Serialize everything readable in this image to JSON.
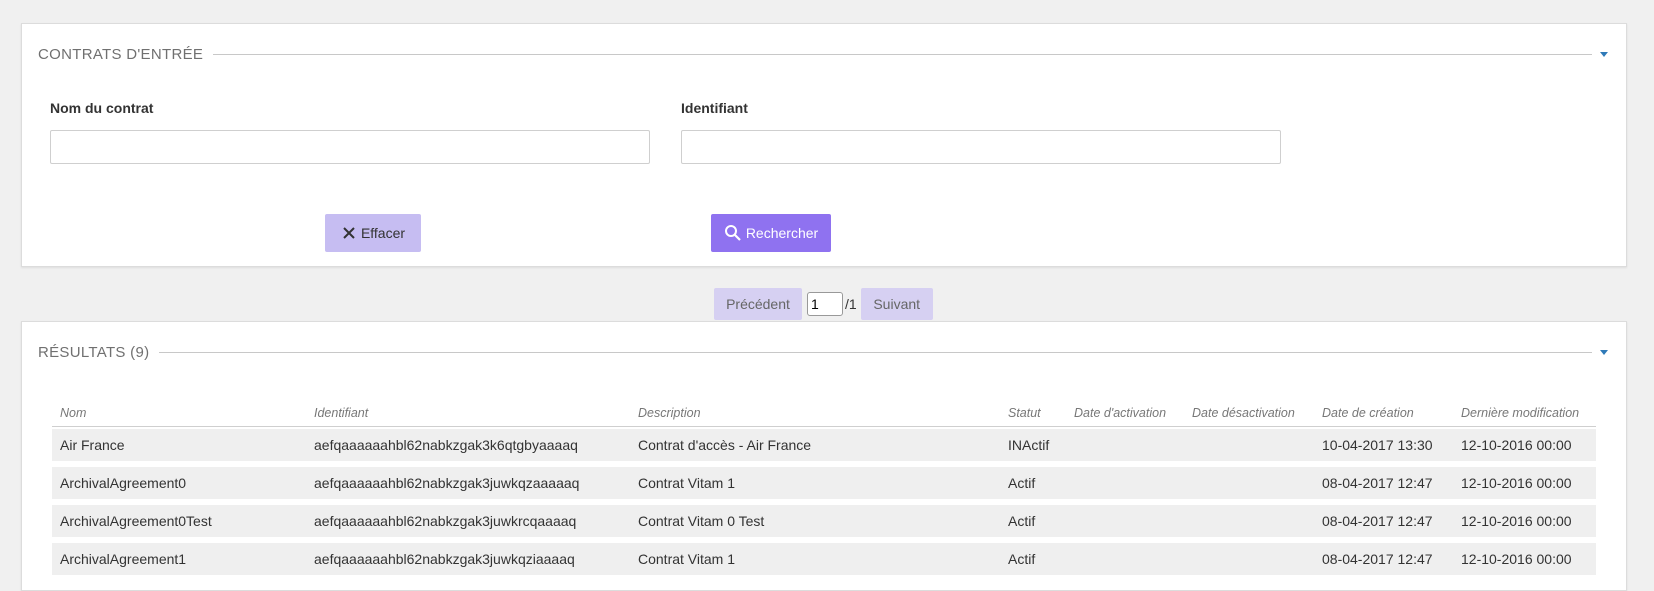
{
  "search_panel": {
    "title": "CONTRATS D'ENTRÉE",
    "fields": {
      "name_label": "Nom du contrat",
      "name_value": "",
      "id_label": "Identifiant",
      "id_value": ""
    },
    "clear_label": "Effacer",
    "search_label": "Rechercher"
  },
  "pager": {
    "prev_label": "Précédent",
    "page": "1",
    "total": "/1",
    "next_label": "Suivant"
  },
  "results_panel": {
    "title": "RÉSULTATS (9)",
    "columns": [
      "Nom",
      "Identifiant",
      "Description",
      "Statut",
      "Date d'activation",
      "Date désactivation",
      "Date de création",
      "Dernière modification"
    ],
    "rows": [
      {
        "nom": "Air France",
        "identifiant": "aefqaaaaaahbl62nabkzgak3k6qtgbyaaaaq",
        "description": "Contrat d'accès - Air France",
        "statut": "INActif",
        "activation": "",
        "desactivation": "",
        "creation": "10-04-2017 13:30",
        "modification": "12-10-2016 00:00"
      },
      {
        "nom": "ArchivalAgreement0",
        "identifiant": "aefqaaaaaahbl62nabkzgak3juwkqzaaaaaq",
        "description": "Contrat Vitam 1",
        "statut": "Actif",
        "activation": "",
        "desactivation": "",
        "creation": "08-04-2017 12:47",
        "modification": "12-10-2016 00:00"
      },
      {
        "nom": "ArchivalAgreement0Test",
        "identifiant": "aefqaaaaaahbl62nabkzgak3juwkrcqaaaaq",
        "description": "Contrat Vitam 0 Test",
        "statut": "Actif",
        "activation": "",
        "desactivation": "",
        "creation": "08-04-2017 12:47",
        "modification": "12-10-2016 00:00"
      },
      {
        "nom": "ArchivalAgreement1",
        "identifiant": "aefqaaaaaahbl62nabkzgak3juwkqziaaaaq",
        "description": "Contrat Vitam 1",
        "statut": "Actif",
        "activation": "",
        "desactivation": "",
        "creation": "08-04-2017 12:47",
        "modification": "12-10-2016 00:00"
      }
    ]
  },
  "colors": {
    "accent": "#8f72f0",
    "accent_light": "#c6bdf2",
    "caret": "#2f7ab8"
  },
  "icons": {
    "clear": "close-icon",
    "search": "search-icon",
    "collapse": "chevron-down-icon"
  }
}
